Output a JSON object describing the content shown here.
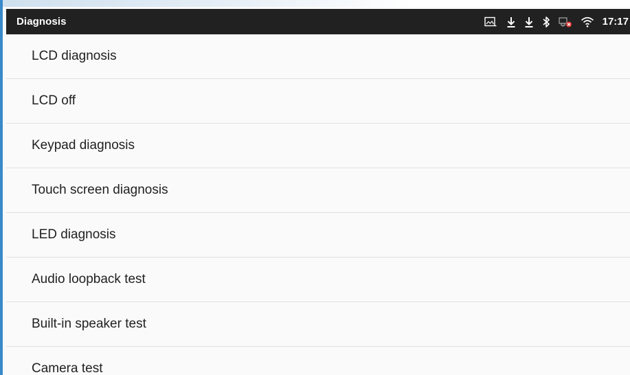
{
  "status_bar": {
    "title": "Diagnosis",
    "time": "17:17",
    "icons": [
      "screenshot-icon",
      "download-icon",
      "download-icon",
      "bluetooth-icon",
      "network-disconnected-icon",
      "wifi-icon"
    ]
  },
  "diagnosis_list": {
    "items": [
      {
        "label": "LCD diagnosis"
      },
      {
        "label": "LCD off"
      },
      {
        "label": "Keypad diagnosis"
      },
      {
        "label": "Touch screen diagnosis"
      },
      {
        "label": "LED diagnosis"
      },
      {
        "label": "Audio loopback test"
      },
      {
        "label": "Built-in speaker test"
      },
      {
        "label": "Camera test"
      }
    ]
  },
  "colors": {
    "status_bar_bg": "#212121",
    "list_bg": "#fafafa",
    "divider": "#e0e0e0",
    "text_primary": "#212121",
    "frame_edge": "#3a89c9",
    "error_badge": "#e53935"
  }
}
